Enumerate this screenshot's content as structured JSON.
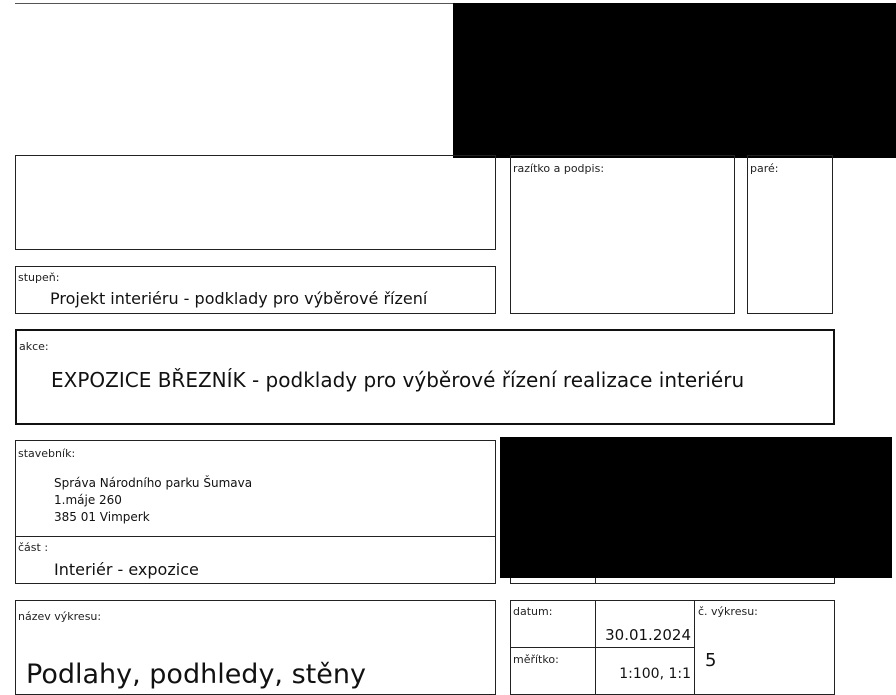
{
  "stamp": {
    "label": "razítko a podpis:"
  },
  "copies": {
    "label": "paré:"
  },
  "stage": {
    "label": "stupeň:",
    "value": "Projekt interiéru - podklady pro výběrové řízení"
  },
  "project": {
    "label": "akce:",
    "value": "EXPOZICE BŘEZNÍK - podklady pro výběrové řízení realizace interiéru"
  },
  "client": {
    "label": "stavebník:",
    "name": "Správa Národního parku Šumava",
    "street": "1.máje 260",
    "city": "385 01 Vimperk"
  },
  "part": {
    "label": "část :",
    "value": "Interiér - expozice"
  },
  "drawing": {
    "label": "název výkresu:",
    "value": "Podlahy, podhledy, stěny"
  },
  "meta": {
    "date_label": "datum:",
    "date_value": "30.01.2024",
    "scale_label": "měřítko:",
    "scale_value": "1:100, 1:1",
    "drawing_no_label": "č. výkresu:",
    "drawing_no_value": "5"
  }
}
